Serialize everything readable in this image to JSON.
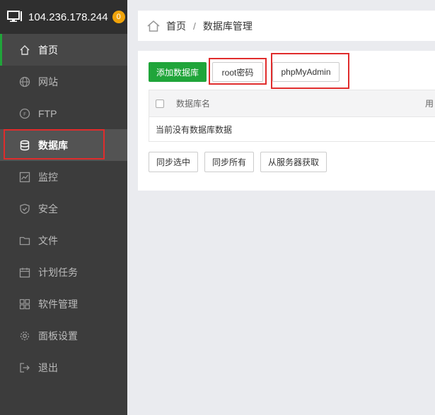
{
  "sidebar": {
    "host": "104.236.178.244",
    "badge": "0",
    "items": [
      {
        "label": "首页"
      },
      {
        "label": "网站"
      },
      {
        "label": "FTP"
      },
      {
        "label": "数据库"
      },
      {
        "label": "监控"
      },
      {
        "label": "安全"
      },
      {
        "label": "文件"
      },
      {
        "label": "计划任务"
      },
      {
        "label": "软件管理"
      },
      {
        "label": "面板设置"
      },
      {
        "label": "退出"
      }
    ]
  },
  "breadcrumb": {
    "home": "首页",
    "separator": "/",
    "current": "数据库管理"
  },
  "toolbar": {
    "add_db": "添加数据库",
    "root_password": "root密码",
    "phpmyadmin": "phpMyAdmin"
  },
  "table": {
    "columns": [
      "数据库名",
      "用"
    ],
    "empty_text": "当前没有数据库数据"
  },
  "footer_buttons": {
    "sync_selected": "同步选中",
    "sync_all": "同步所有",
    "fetch_server": "从服务器获取"
  },
  "colors": {
    "accent_green": "#20a53a",
    "highlight_red": "#e02c2c",
    "badge_orange": "#f0a30a",
    "sidebar_bg": "#3c3c3c"
  }
}
